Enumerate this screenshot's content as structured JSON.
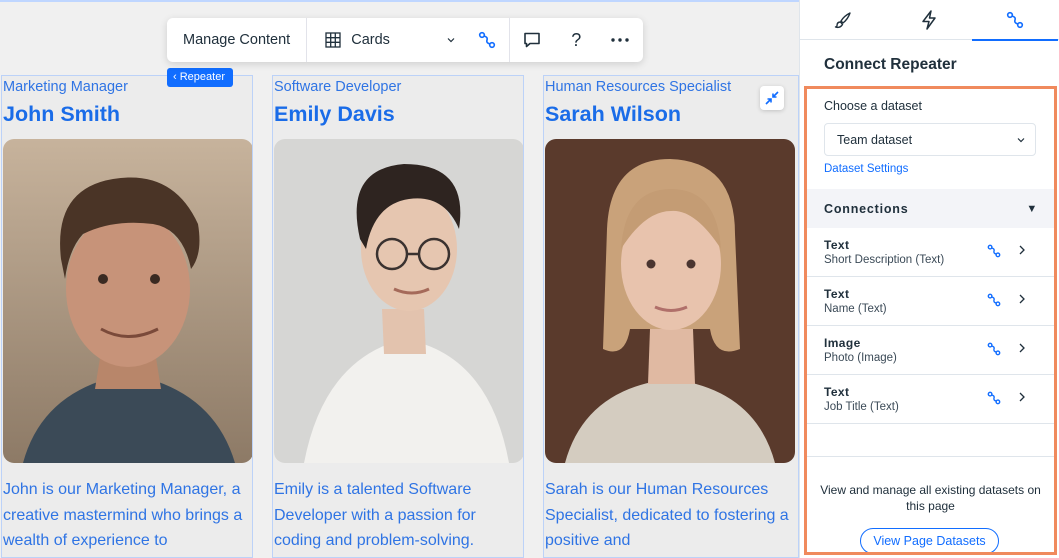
{
  "toolbar": {
    "manage_label": "Manage Content",
    "layout_label": "Cards"
  },
  "repeater": {
    "tag_label": "Repeater",
    "items": [
      {
        "job_title": "Marketing Manager",
        "name": "John Smith",
        "description": "John is our Marketing Manager, a creative mastermind who brings a wealth of experience to"
      },
      {
        "job_title": "Software Developer",
        "name": "Emily Davis",
        "description": "Emily is a talented Software Developer with a passion for coding and problem-solving."
      },
      {
        "job_title": "Human Resources Specialist",
        "name": "Sarah Wilson",
        "description": "Sarah is our Human Resources Specialist, dedicated to fostering a positive and"
      }
    ]
  },
  "panel": {
    "title": "Connect Repeater",
    "choose_label": "Choose a dataset",
    "dataset_value": "Team dataset",
    "dataset_settings_label": "Dataset Settings",
    "connections_label": "Connections",
    "connections": [
      {
        "type": "Text",
        "field": "Short Description (Text)"
      },
      {
        "type": "Text",
        "field": "Name (Text)"
      },
      {
        "type": "Image",
        "field": "Photo (Image)"
      },
      {
        "type": "Text",
        "field": "Job Title (Text)"
      }
    ],
    "footer_text": "View and manage all existing datasets on this page",
    "footer_button": "View Page Datasets"
  },
  "icons": {
    "tab_design": "paintbrush-icon",
    "tab_interactions": "lightning-icon",
    "tab_connect": "connect-data-icon"
  },
  "colors": {
    "accent": "#116dff",
    "highlight_border": "#f08a5d",
    "card_text": "#2f74e4"
  }
}
